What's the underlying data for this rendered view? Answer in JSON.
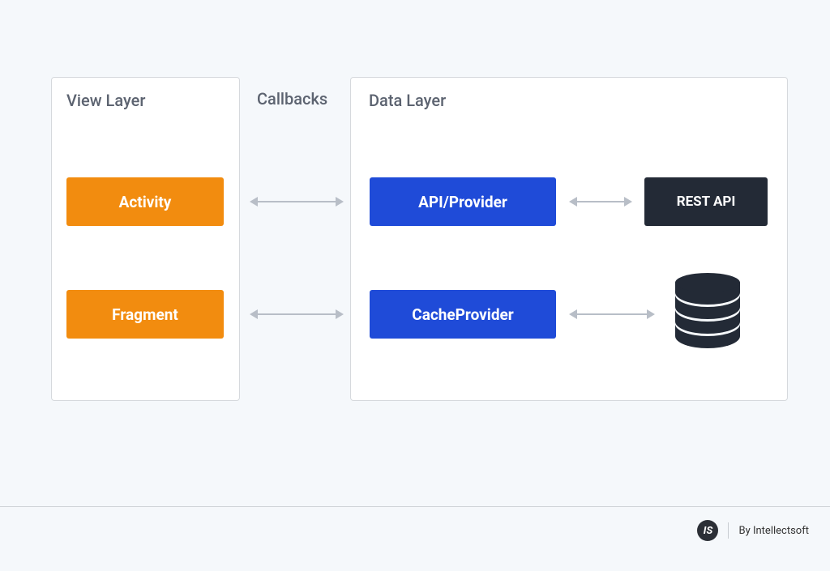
{
  "view_layer": {
    "title": "View Layer",
    "activity_label": "Activity",
    "fragment_label": "Fragment"
  },
  "callbacks_label": "Callbacks",
  "data_layer": {
    "title": "Data Layer",
    "api_provider_label": "API/Provider",
    "cache_provider_label": "CacheProvider",
    "rest_api_label": "REST API"
  },
  "attribution": {
    "text": "By Intellectsoft",
    "mark_glyph": "IS"
  },
  "colors": {
    "orange": "#f28c0f",
    "blue": "#1f4bd8",
    "dark": "#232a36",
    "panel_bg": "#ffffff",
    "page_bg": "#f5f8fb",
    "arrow": "#b8bec7"
  },
  "chart_data": {
    "type": "diagram",
    "title": "",
    "layers": [
      {
        "name": "View Layer",
        "components": [
          "Activity",
          "Fragment"
        ]
      },
      {
        "name": "Data Layer",
        "components": [
          "API/Provider",
          "CacheProvider",
          "REST API",
          "Database"
        ]
      }
    ],
    "edges": [
      {
        "from": "Activity",
        "to": "API/Provider",
        "label": "Callbacks",
        "bidirectional": true
      },
      {
        "from": "Fragment",
        "to": "CacheProvider",
        "label": "Callbacks",
        "bidirectional": true
      },
      {
        "from": "API/Provider",
        "to": "REST API",
        "bidirectional": true
      },
      {
        "from": "CacheProvider",
        "to": "Database",
        "bidirectional": true
      }
    ]
  }
}
